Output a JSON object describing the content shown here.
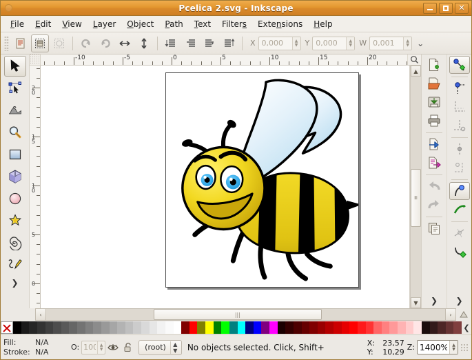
{
  "window": {
    "title": "Pcelica 2.svg - Inkscape",
    "buttons": [
      {
        "name": "minimize",
        "glyph": "min"
      },
      {
        "name": "maximize",
        "glyph": "max"
      },
      {
        "name": "close",
        "glyph": "✕"
      }
    ]
  },
  "menubar": {
    "items": [
      {
        "label": "File",
        "mnemonic": "F"
      },
      {
        "label": "Edit",
        "mnemonic": "E"
      },
      {
        "label": "View",
        "mnemonic": "V"
      },
      {
        "label": "Layer",
        "mnemonic": "L"
      },
      {
        "label": "Object",
        "mnemonic": "O"
      },
      {
        "label": "Path",
        "mnemonic": "P"
      },
      {
        "label": "Text",
        "mnemonic": "T"
      },
      {
        "label": "Filters",
        "mnemonic": "s"
      },
      {
        "label": "Extensions",
        "mnemonic": "n"
      },
      {
        "label": "Help",
        "mnemonic": "H"
      }
    ]
  },
  "toolbar": {
    "buttons": [
      {
        "name": "select-all-icon",
        "enabled": true
      },
      {
        "name": "select-all-in-all-layers-icon",
        "enabled": true
      },
      {
        "name": "deselect-icon",
        "enabled": false
      },
      {
        "name": "rotate-ccw-icon",
        "enabled": false
      },
      {
        "name": "rotate-cw-icon",
        "enabled": false
      },
      {
        "name": "flip-horizontal-icon",
        "enabled": true
      },
      {
        "name": "flip-vertical-icon",
        "enabled": true
      },
      {
        "name": "raise-to-top-icon",
        "enabled": true
      },
      {
        "name": "raise-icon",
        "enabled": true
      },
      {
        "name": "lower-icon",
        "enabled": true
      },
      {
        "name": "lower-to-bottom-icon",
        "enabled": true
      }
    ],
    "fields": [
      {
        "label": "X",
        "value": "0,000"
      },
      {
        "label": "Y",
        "value": "0,000"
      },
      {
        "label": "W",
        "value": "0,001"
      }
    ],
    "overflow_glyph": "⌄"
  },
  "toolbox": {
    "tools": [
      {
        "name": "selector-tool",
        "label": "Selector",
        "active": true
      },
      {
        "name": "node-tool",
        "label": "Node editor",
        "active": false
      },
      {
        "name": "tweak-tool",
        "label": "Tweak",
        "active": false
      },
      {
        "name": "zoom-tool",
        "label": "Zoom",
        "active": false
      },
      {
        "name": "rectangle-tool",
        "label": "Rectangle",
        "active": false
      },
      {
        "name": "box3d-tool",
        "label": "3D Box",
        "active": false
      },
      {
        "name": "ellipse-tool",
        "label": "Ellipse",
        "active": false
      },
      {
        "name": "star-tool",
        "label": "Star",
        "active": false
      },
      {
        "name": "spiral-tool",
        "label": "Spiral",
        "active": false
      },
      {
        "name": "pencil-tool",
        "label": "Pencil",
        "active": false
      }
    ],
    "more_glyph": "❯"
  },
  "rulers": {
    "unit": "px",
    "horizontal_labels": [
      "-10",
      "-5",
      "0",
      "5",
      "10",
      "15",
      "20"
    ],
    "vertical_labels": [
      "20",
      "15",
      "10",
      "5",
      "0"
    ]
  },
  "canvas": {
    "document_name": "Pcelica 2.svg",
    "artwork": "cartoon-bee",
    "colors": {
      "body_yellow": "#e8c81a",
      "body_yellow_dark": "#b79c0d",
      "body_black": "#000000",
      "wing_light": "#ffffff",
      "wing_blue": "#bfe0f2",
      "eye_blue": "#2aa8e8",
      "eye_white": "#ffffff",
      "page_border": "#4a4a4a",
      "page_shadow": "#6e6e6e"
    }
  },
  "dock": {
    "commands": [
      {
        "name": "new-document-icon"
      },
      {
        "name": "open-document-icon"
      },
      {
        "name": "save-document-icon"
      },
      {
        "name": "print-document-icon"
      },
      {
        "name": "import-icon"
      },
      {
        "name": "export-icon"
      },
      {
        "name": "undo-icon",
        "enabled": false
      },
      {
        "name": "redo-icon",
        "enabled": false
      },
      {
        "name": "duplicate-icon"
      }
    ],
    "snap": [
      {
        "name": "snap-enable-icon",
        "active": true
      },
      {
        "name": "snap-to-nodes-icon",
        "active": false
      },
      {
        "name": "snap-to-bounding-box-icon",
        "active": false
      },
      {
        "name": "snap-to-paths-icon",
        "active": false
      },
      {
        "name": "snap-to-midpoints-icon",
        "active": false
      },
      {
        "name": "snap-to-object-centers-icon",
        "active": false
      },
      {
        "name": "snap-to-path-node-icon",
        "active": true
      },
      {
        "name": "snap-to-path-intersection-icon",
        "active": false
      },
      {
        "name": "snap-to-cusp-node-icon",
        "active": false
      },
      {
        "name": "snap-to-smooth-node-icon",
        "active": false
      }
    ],
    "more_glyph": "❯"
  },
  "scrollbars": {
    "horizontal_thumb_glyph": "⦀",
    "vertical_thumb_glyph": "≡",
    "left_arrow": "‹",
    "right_arrow": "›",
    "up_arrow": "▲",
    "down_arrow": "▼"
  },
  "palette": {
    "none_label": "None",
    "swatches": [
      "#000000",
      "#1a1a1a",
      "#262626",
      "#333333",
      "#404040",
      "#4d4d4d",
      "#595959",
      "#666666",
      "#737373",
      "#808080",
      "#8c8c8c",
      "#999999",
      "#a6a6a6",
      "#b3b3b3",
      "#bfbfbf",
      "#cccccc",
      "#d9d9d9",
      "#e6e6e6",
      "#f2f2f2",
      "#fafafa",
      "#ffffff",
      "#800000",
      "#ff0000",
      "#808000",
      "#ffff00",
      "#008000",
      "#00ff00",
      "#008080",
      "#00ffff",
      "#000080",
      "#0000ff",
      "#800080",
      "#ff00ff",
      "#1a0000",
      "#330000",
      "#4d0000",
      "#660000",
      "#800000",
      "#990000",
      "#b30000",
      "#cc0000",
      "#e60000",
      "#ff0000",
      "#ff1a1a",
      "#ff3333",
      "#ff6666",
      "#ff8080",
      "#ff9999",
      "#ffb3b3",
      "#ffcccc",
      "#ffe6e6",
      "#1a0d0d",
      "#331a1a",
      "#4d2626",
      "#663333",
      "#803f3f"
    ],
    "next_glyph": "❮"
  },
  "statusbar": {
    "fill": {
      "label": "Fill:",
      "value": "N/A"
    },
    "stroke": {
      "label": "Stroke:",
      "value": "N/A"
    },
    "opacity": {
      "label": "O:",
      "value": "100"
    },
    "visibility_icon": "eye-icon",
    "lock_icon": "unlock-icon",
    "layer": {
      "name": "(root)"
    },
    "message": "No objects selected. Click, Shift+",
    "coords": {
      "x_label": "X:",
      "x_value": "23,57",
      "y_label": "Y:",
      "y_value": "10,29"
    },
    "zoom": {
      "label": "Z:",
      "value": "1400%"
    }
  }
}
